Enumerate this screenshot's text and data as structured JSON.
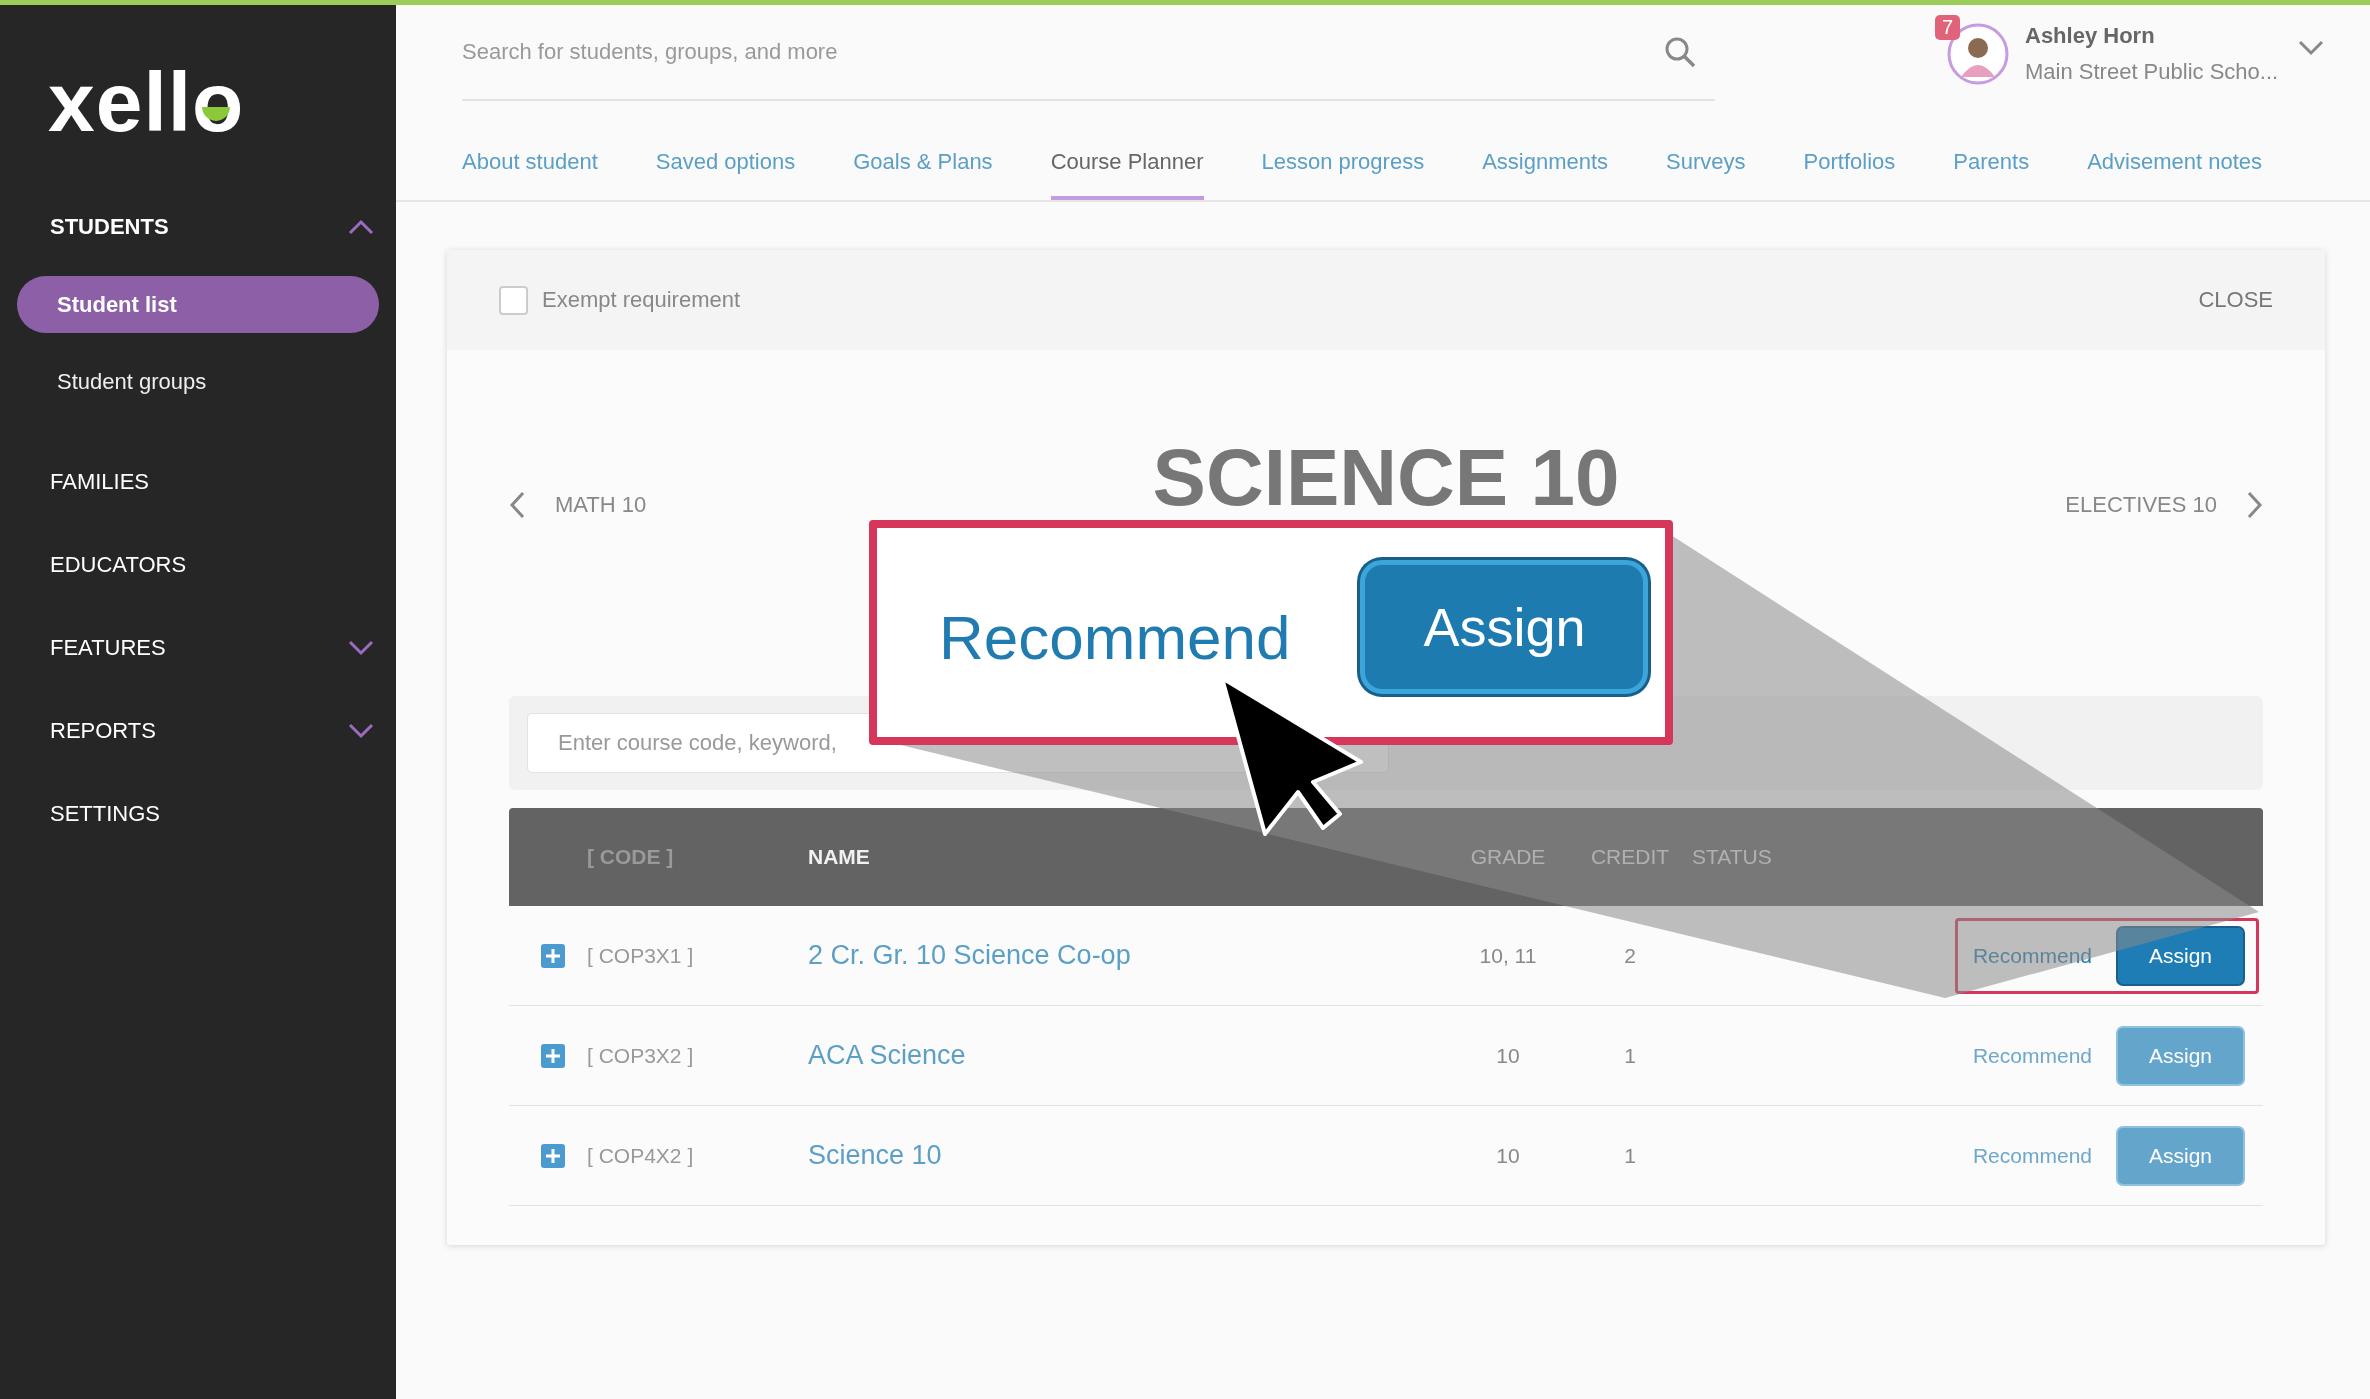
{
  "sidebar": {
    "logo": "xello",
    "sections": [
      {
        "label": "STUDENTS",
        "expanded": true,
        "children": [
          {
            "label": "Student list",
            "selected": true
          },
          {
            "label": "Student groups",
            "selected": false
          }
        ]
      },
      {
        "label": "FAMILIES"
      },
      {
        "label": "EDUCATORS"
      },
      {
        "label": "FEATURES",
        "expanded": false
      },
      {
        "label": "REPORTS",
        "expanded": false
      },
      {
        "label": "SETTINGS"
      }
    ]
  },
  "header": {
    "search": {
      "placeholder": "Search for students, groups, and more"
    },
    "user": {
      "badge": "7",
      "name": "Ashley Horn",
      "school": "Main Street Public Scho..."
    }
  },
  "tabs": [
    {
      "label": "About student",
      "selected": false
    },
    {
      "label": "Saved options",
      "selected": false
    },
    {
      "label": "Goals & Plans",
      "selected": false
    },
    {
      "label": "Course Planner",
      "selected": true
    },
    {
      "label": "Lesson progress",
      "selected": false
    },
    {
      "label": "Assignments",
      "selected": false
    },
    {
      "label": "Surveys",
      "selected": false
    },
    {
      "label": "Portfolios",
      "selected": false
    },
    {
      "label": "Parents",
      "selected": false
    },
    {
      "label": "Advisement notes",
      "selected": false
    }
  ],
  "panel": {
    "exempt": {
      "label": "Exempt requirement",
      "checked": false
    },
    "close": "CLOSE",
    "previous": "MATH 10",
    "title": "SCIENCE 10",
    "next": "ELECTIVES 10",
    "search": {
      "placeholder": "Enter course code, keyword,"
    },
    "table": {
      "columns": [
        "[ CODE ]",
        "NAME",
        "GRADE",
        "CREDIT",
        "STATUS"
      ],
      "rows": [
        {
          "code": "[ COP3X1 ]",
          "name": "2 Cr. Gr. 10 Science Co-op",
          "grade": "10, 11",
          "credit": "2",
          "recommend": "Recommend",
          "assign": "Assign",
          "highlighted": true
        },
        {
          "code": "[ COP3X2 ]",
          "name": "ACA Science",
          "grade": "10",
          "credit": "1",
          "recommend": "Recommend",
          "assign": "Assign",
          "highlighted": false
        },
        {
          "code": "[ COP4X2 ]",
          "name": "Science 10",
          "grade": "10",
          "credit": "1",
          "recommend": "Recommend",
          "assign": "Assign",
          "highlighted": false
        }
      ]
    }
  },
  "callout": {
    "recommend": "Recommend",
    "assign": "Assign"
  }
}
